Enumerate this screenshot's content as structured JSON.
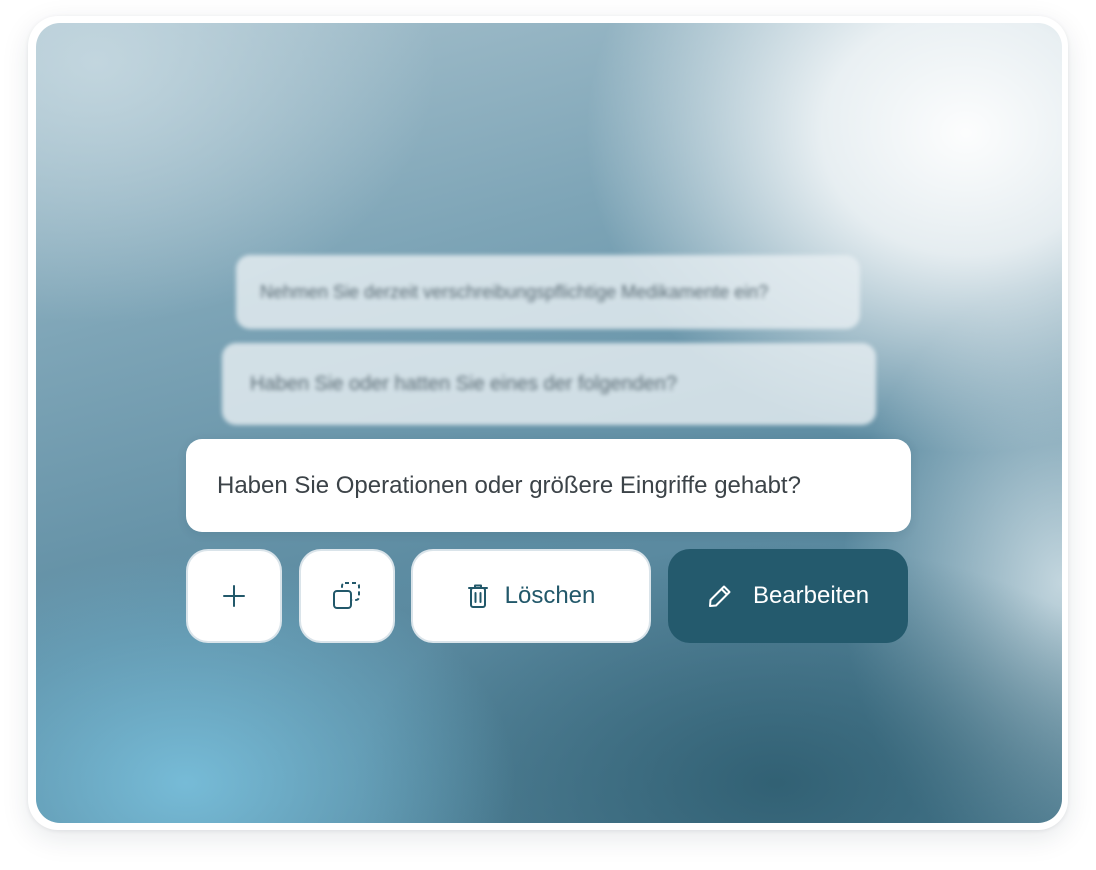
{
  "background_questions": [
    "Nehmen Sie derzeit verschreibungspflichtige Medikamente ein?",
    "Haben Sie oder hatten Sie eines der folgenden?"
  ],
  "active_question": "Haben Sie Operationen oder größere Eingriffe gehabt?",
  "actions": {
    "add_icon": "plus-icon",
    "duplicate_icon": "duplicate-icon",
    "delete_icon": "trash-icon",
    "delete_label": "Löschen",
    "edit_icon": "pencil-icon",
    "edit_label": "Bearbeiten"
  },
  "colors": {
    "accent": "#245a6d",
    "on_accent": "#ffffff",
    "icon_light": "#22586a"
  }
}
